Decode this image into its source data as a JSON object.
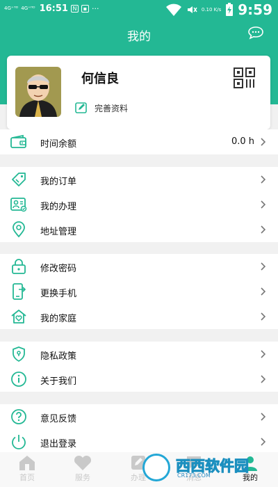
{
  "status_bar": {
    "signal1": "4G⁺ᴴᴰ",
    "signal2": "4G⁺ᴴᴰ",
    "time": "16:51",
    "extra": "···",
    "net_speed": "0.10 K/s",
    "clock": "9:59"
  },
  "header": {
    "title": "我的",
    "bg_color": "#23b894"
  },
  "profile": {
    "name": "何信良",
    "edit_label": "完善资料"
  },
  "balance": {
    "label": "时间余额",
    "value": "0.0 h"
  },
  "groups": [
    {
      "items": [
        {
          "id": "orders",
          "label": "我的订单",
          "icon": "tag-icon"
        },
        {
          "id": "handling",
          "label": "我的办理",
          "icon": "id-card-icon"
        },
        {
          "id": "address",
          "label": "地址管理",
          "icon": "location-pin-icon"
        }
      ]
    },
    {
      "items": [
        {
          "id": "password",
          "label": "修改密码",
          "icon": "lock-icon"
        },
        {
          "id": "phone",
          "label": "更换手机",
          "icon": "phone-icon"
        },
        {
          "id": "family",
          "label": "我的家庭",
          "icon": "home-heart-icon"
        }
      ]
    },
    {
      "items": [
        {
          "id": "privacy",
          "label": "隐私政策",
          "icon": "shield-icon"
        },
        {
          "id": "about",
          "label": "关于我们",
          "icon": "info-icon"
        }
      ]
    },
    {
      "items": [
        {
          "id": "feedback",
          "label": "意见反馈",
          "icon": "help-icon"
        },
        {
          "id": "logout",
          "label": "退出登录",
          "icon": "power-icon"
        }
      ]
    }
  ],
  "tabbar": {
    "tabs": [
      {
        "label": "首页",
        "icon": "home-icon"
      },
      {
        "label": "服务",
        "icon": "heart-icon"
      },
      {
        "label": "办理",
        "icon": "edit-icon"
      },
      {
        "label": "消息",
        "icon": "message-icon"
      },
      {
        "label": "我的",
        "icon": "user-icon"
      }
    ],
    "active_index": 4
  },
  "watermark": {
    "text": "西西软件园",
    "sub": "CR173.COM"
  },
  "accent_color": "#23b894"
}
